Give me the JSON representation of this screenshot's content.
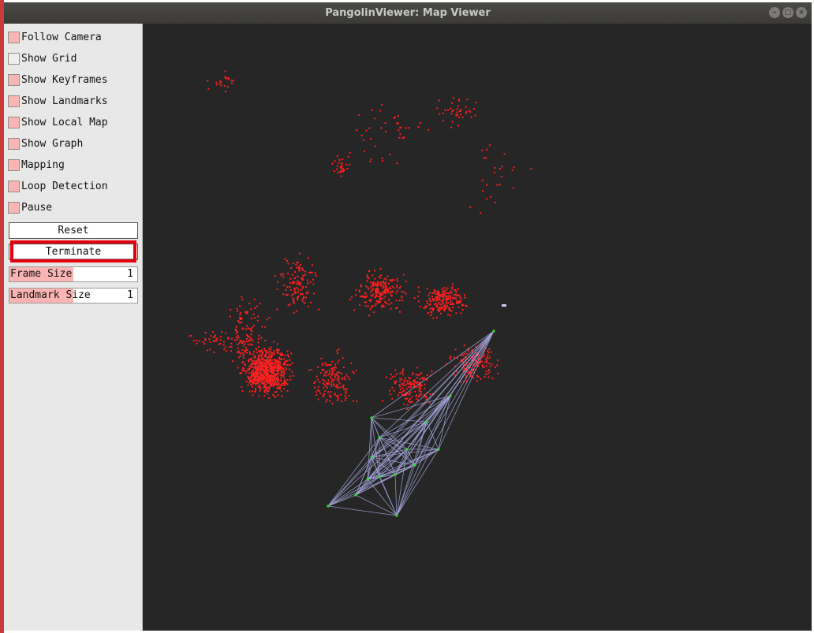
{
  "window": {
    "title": "PangolinViewer: Map Viewer"
  },
  "panel": {
    "checkboxes": [
      {
        "label": "Follow Camera",
        "checked": true
      },
      {
        "label": "Show Grid",
        "checked": false
      },
      {
        "label": "Show Keyframes",
        "checked": true
      },
      {
        "label": "Show Landmarks",
        "checked": true
      },
      {
        "label": "Show Local Map",
        "checked": true
      },
      {
        "label": "Show Graph",
        "checked": true
      },
      {
        "label": "Mapping",
        "checked": true
      },
      {
        "label": "Loop Detection",
        "checked": true
      },
      {
        "label": "Pause",
        "checked": true
      }
    ],
    "reset_label": "Reset",
    "terminate_label": "Terminate",
    "sliders": [
      {
        "label": "Frame Size",
        "value": "1",
        "fraction": 0.5
      },
      {
        "label": "Landmark Size",
        "value": "1",
        "fraction": 0.5
      }
    ]
  },
  "colors": {
    "landmark": "#ff2020",
    "graph_edge": "#a3a6dc",
    "keyframe": "#30e030",
    "checkbox_on": "#fbb4b4",
    "highlight": "#e3000d",
    "background": "#262626"
  }
}
